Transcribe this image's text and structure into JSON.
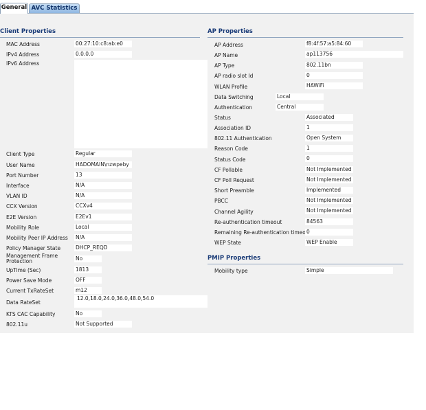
{
  "tabs": [
    {
      "label": "General",
      "active": true
    },
    {
      "label": "AVC Statistics",
      "active": false
    }
  ],
  "client": {
    "title": "Client Properties",
    "mac_label": "MAC Address",
    "mac": "00:27:10:c8:ab:e0",
    "ipv4_label": "IPv4 Address",
    "ipv4": "0.0.0.0",
    "ipv6_label": "IPv6 Address",
    "ipv6": "",
    "client_type_label": "Client Type",
    "client_type": "Regular",
    "user_name_label": "User Name",
    "user_name": "HADOMAIN\\nzwpeby",
    "port_label": "Port Number",
    "port": "13",
    "interface_label": "Interface",
    "interface": "N/A",
    "vlan_label": "VLAN ID",
    "vlan": "N/A",
    "ccx_label": "CCX Version",
    "ccx": "CCXv4",
    "e2e_label": "E2E Version",
    "e2e": "E2Ev1",
    "mobility_role_label": "Mobility Role",
    "mobility_role": "Local",
    "peer_ip_label": "Mobility Peer IP Address",
    "peer_ip": "N/A",
    "policy_label": "Policy Manager State",
    "policy": "DHCP_REQD",
    "mfp_label": "Management Frame Protection",
    "mfp": "No",
    "uptime_label": "UpTime (Sec)",
    "uptime": "1813",
    "power_save_label": "Power Save Mode",
    "power_save": "OFF",
    "txrate_label": "Current TxRateSet",
    "txrate": "m12",
    "dataset_label": "Data RateSet",
    "dataset": "12.0,18.0,24.0,36.0,48.0,54.0",
    "kts_label": "KTS CAC Capability",
    "kts": "No",
    "dot11u_label": "802.11u",
    "dot11u": "Not Supported"
  },
  "ap": {
    "title": "AP Properties",
    "address_label": "AP Address",
    "address": "f8:4f:57:a5:84:60",
    "name_label": "AP Name",
    "name": "ap113756",
    "type_label": "AP Type",
    "type": "802.11bn",
    "slot_label": "AP radio slot Id",
    "slot": "0",
    "wlan_label": "WLAN Profile",
    "wlan": "HAWiFi",
    "switching_label": "Data Switching",
    "switching": "Local",
    "auth_label": "Authentication",
    "auth": "Central",
    "status_label": "Status",
    "status": "Associated",
    "assoc_label": "Association ID",
    "assoc": "1",
    "dot11auth_label": "802.11 Authentication",
    "dot11auth": "Open System",
    "reason_label": "Reason Code",
    "reason": "1",
    "status_code_label": "Status Code",
    "status_code": "0",
    "cf_pollable_label": "CF Pollable",
    "cf_pollable": "Not Implemented",
    "cf_poll_req_label": "CF Poll Request",
    "cf_poll_req": "Not Implemented",
    "preamble_label": "Short Preamble",
    "preamble": "Implemented",
    "pbcc_label": "PBCC",
    "pbcc": "Not Implemented",
    "agility_label": "Channel Agility",
    "agility": "Not Implemented",
    "reauth_label": "Re-authentication timeout",
    "reauth": "84563",
    "remaining_label": "Remaining Re-authentication timeout",
    "remaining": "0",
    "wep_label": "WEP State",
    "wep": "WEP Enable"
  },
  "pmip": {
    "title": "PMIP Properties",
    "mobility_type_label": "Mobility type",
    "mobility_type": "Simple"
  }
}
